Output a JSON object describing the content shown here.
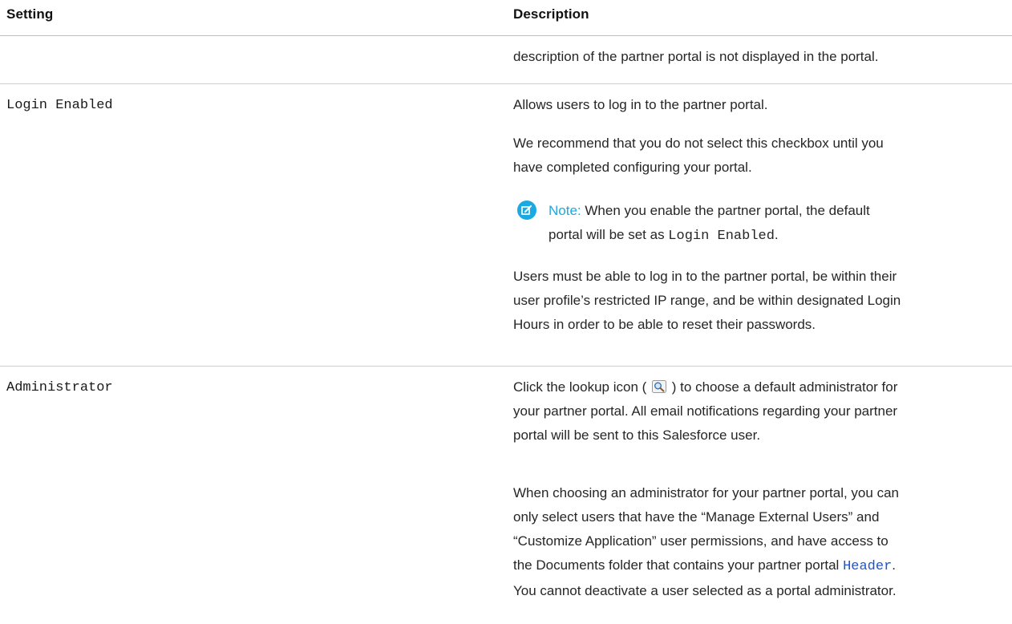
{
  "table": {
    "header": {
      "setting": "Setting",
      "description": "Description"
    },
    "row0": {
      "desc": "description of the partner portal is not displayed in the portal."
    },
    "row1": {
      "setting": "Login Enabled",
      "desc_p1": "Allows users to log in to the partner portal.",
      "desc_p2_line1": "We recommend that you do not select this checkbox until you",
      "desc_p2_line2": "have completed configuring your portal.",
      "note_label": "Note:",
      "note_line1": "When you enable the partner portal, the default",
      "note_line2_prefix": "portal will be set as ",
      "note_line2_code": "Login Enabled",
      "note_line2_suffix": ".",
      "desc_p3_line1": "Users must be able to log in to the partner portal, be within their",
      "desc_p3_line2": "user profile’s restricted IP range, and be within designated Login",
      "desc_p3_line3": "Hours in order to be able to reset their passwords."
    },
    "row2": {
      "setting": "Administrator",
      "desc_p1_line1_prefix": "Click the lookup icon (",
      "desc_p1_line1_suffix": ") to choose a default administrator for",
      "desc_p1_line2": "your partner portal. All email notifications regarding your partner",
      "desc_p1_line3": "portal will be sent to this Salesforce user.",
      "desc_p2_line1": "When choosing an administrator for your partner portal, you can",
      "desc_p2_line2": "only select users that have the “Manage External Users” and",
      "desc_p2_line3": "“Customize Application” user permissions, and have access to",
      "desc_p2_line4_prefix": "the Documents folder that contains your partner portal ",
      "desc_p2_line4_link": "Header",
      "desc_p2_line4_suffix": ".",
      "desc_p2_line5": "You cannot deactivate a user selected as a portal administrator."
    }
  },
  "icons": {
    "note": "note-edit-icon",
    "lookup": "lookup-magnifier-icon"
  },
  "colors": {
    "note_accent": "#1ba9e1",
    "link": "#1a55d6",
    "border": "#cfcfcf"
  }
}
